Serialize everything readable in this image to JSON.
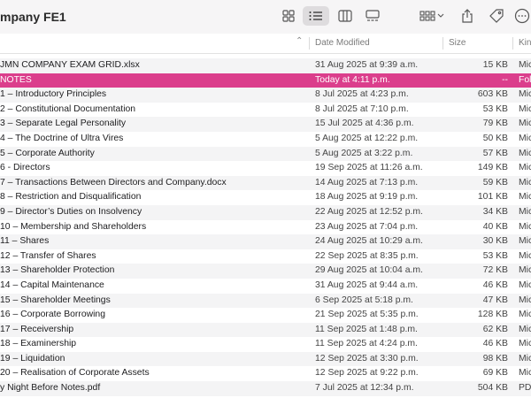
{
  "window": {
    "title": "mpany FE1"
  },
  "toolbar": {
    "icons": [
      "grid-view-icon",
      "list-view-icon",
      "column-view-icon",
      "gallery-view-icon",
      "group-by-icon",
      "share-icon",
      "tag-icon",
      "more-icon"
    ],
    "active_view": "list"
  },
  "columns": {
    "name": "",
    "date": "Date Modified",
    "size": "Size",
    "kind": "Kin"
  },
  "colors": {
    "selection": "#db3e8c"
  },
  "files": [
    {
      "name": "JMN COMPANY EXAM GRID.xlsx",
      "date": "31 Aug 2025 at 9:39 a.m.",
      "size": "15 KB",
      "kind": "Mic"
    },
    {
      "name": "NOTES",
      "date": "Today at 4:11 p.m.",
      "size": "--",
      "kind": "Fol"
    },
    {
      "name": "1 – Introductory Principles",
      "date": "8 Jul 2025 at 4:23 p.m.",
      "size": "603 KB",
      "kind": "Mic"
    },
    {
      "name": "2 – Constitutional Documentation",
      "date": "8 Jul 2025 at 7:10 p.m.",
      "size": "53 KB",
      "kind": "Mic"
    },
    {
      "name": "3 – Separate Legal Personality",
      "date": "15 Jul 2025 at 4:36 p.m.",
      "size": "79 KB",
      "kind": "Mic"
    },
    {
      "name": "4 – The Doctrine of Ultra Vires",
      "date": "5 Aug 2025 at 12:22 p.m.",
      "size": "50 KB",
      "kind": "Mic"
    },
    {
      "name": "5 – Corporate Authority",
      "date": "5 Aug 2025 at 3:22 p.m.",
      "size": "57 KB",
      "kind": "Mic"
    },
    {
      "name": "6 - Directors",
      "date": "19 Sep 2025 at 11:26 a.m.",
      "size": "149 KB",
      "kind": "Mic"
    },
    {
      "name": "7 – Transactions Between Directors and Company.docx",
      "date": "14 Aug 2025 at 7:13 p.m.",
      "size": "59 KB",
      "kind": "Mic"
    },
    {
      "name": "8 – Restriction and Disqualification",
      "date": "18 Aug 2025 at 9:19 p.m.",
      "size": "101 KB",
      "kind": "Mic"
    },
    {
      "name": "9 – Director’s Duties on Insolvency",
      "date": "22 Aug 2025 at 12:52 p.m.",
      "size": "34 KB",
      "kind": "Mic"
    },
    {
      "name": "10 – Membership and Shareholders",
      "date": "23 Aug 2025 at 7:04 p.m.",
      "size": "40 KB",
      "kind": "Mic"
    },
    {
      "name": "11 – Shares",
      "date": "24 Aug 2025 at 10:29 a.m.",
      "size": "30 KB",
      "kind": "Mic"
    },
    {
      "name": "12 – Transfer of Shares",
      "date": "22 Sep 2025 at 8:35 p.m.",
      "size": "53 KB",
      "kind": "Mic"
    },
    {
      "name": "13 – Shareholder Protection",
      "date": "29 Aug 2025 at 10:04 a.m.",
      "size": "72 KB",
      "kind": "Mic"
    },
    {
      "name": "14 – Capital Maintenance",
      "date": "31 Aug 2025 at 9:44 a.m.",
      "size": "46 KB",
      "kind": "Mic"
    },
    {
      "name": "15 – Shareholder Meetings",
      "date": "6 Sep 2025 at 5:18 p.m.",
      "size": "47 KB",
      "kind": "Mic"
    },
    {
      "name": "16 – Corporate Borrowing",
      "date": "21 Sep 2025 at 5:35 p.m.",
      "size": "128 KB",
      "kind": "Mic"
    },
    {
      "name": "17 – Receivership",
      "date": "11 Sep 2025 at 1:48 p.m.",
      "size": "62 KB",
      "kind": "Mic"
    },
    {
      "name": "18 – Examinership",
      "date": "11 Sep 2025 at 4:24 p.m.",
      "size": "46 KB",
      "kind": "Mic"
    },
    {
      "name": "19 – Liquidation",
      "date": "12 Sep 2025 at 3:30 p.m.",
      "size": "98 KB",
      "kind": "Mic"
    },
    {
      "name": "20 – Realisation of Corporate Assets",
      "date": "12 Sep 2025 at 9:22 p.m.",
      "size": "69 KB",
      "kind": "Mic"
    },
    {
      "name": "y Night Before Notes.pdf",
      "date": "7 Jul 2025 at 12:34 p.m.",
      "size": "504 KB",
      "kind": "PDF"
    }
  ],
  "selected_index": 1
}
